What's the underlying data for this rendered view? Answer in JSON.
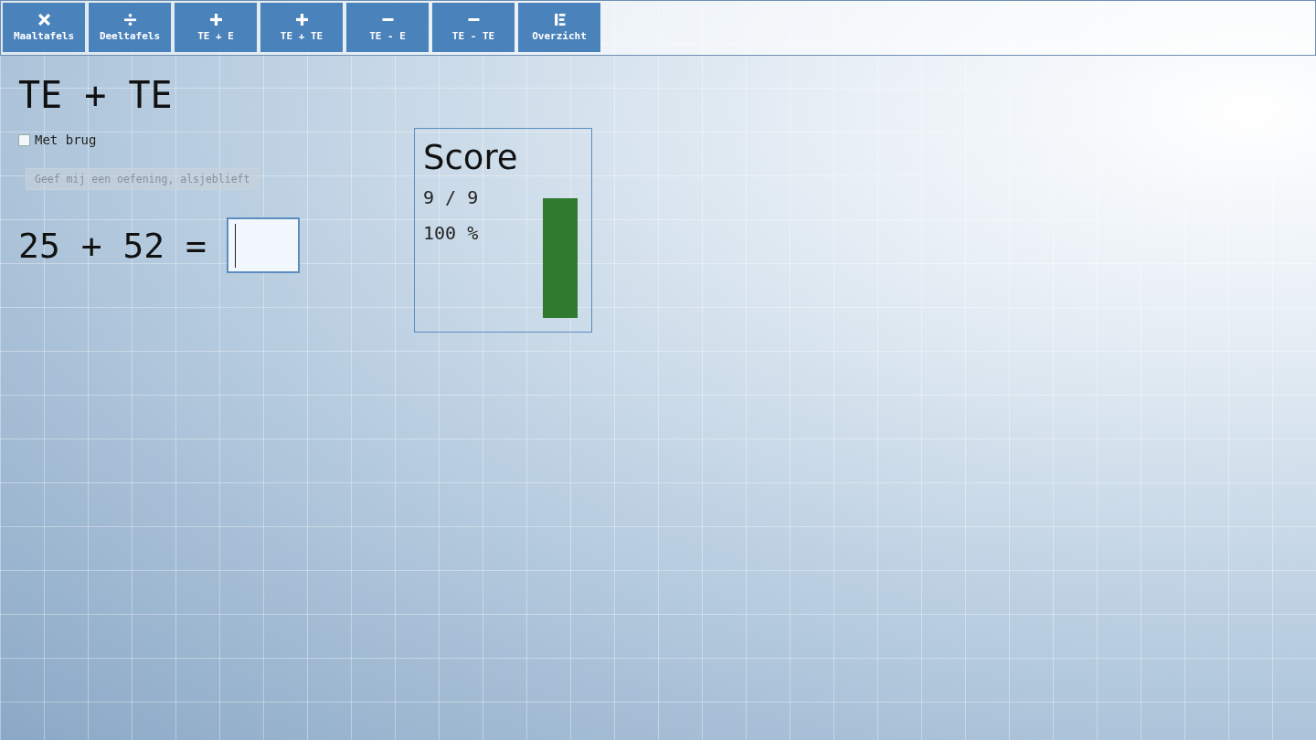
{
  "toolbar": [
    {
      "kind": "times",
      "label": "Maaltafels"
    },
    {
      "kind": "divide",
      "label": "Deeltafels"
    },
    {
      "kind": "plus",
      "label": "TE + E"
    },
    {
      "kind": "plus",
      "label": "TE + TE"
    },
    {
      "kind": "minus",
      "label": "TE - E"
    },
    {
      "kind": "minus",
      "label": "TE - TE"
    },
    {
      "kind": "list",
      "label": "Overzicht"
    }
  ],
  "title": "TE + TE",
  "option": {
    "label": "Met brug",
    "checked": false
  },
  "request_button": {
    "label": "Geef mij een oefening, alsjeblieft",
    "disabled": true
  },
  "exercise": {
    "question": "25 + 52 ="
  },
  "score": {
    "title": "Score",
    "count": "9 / 9",
    "percent": "100 %"
  }
}
